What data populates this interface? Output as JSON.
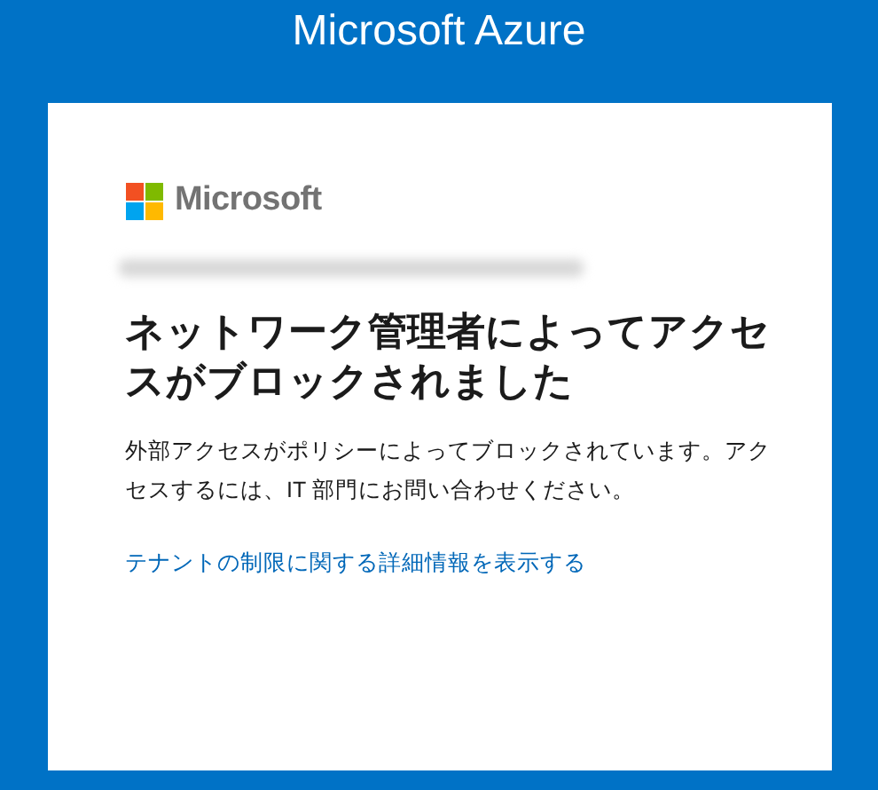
{
  "header": {
    "title": "Microsoft Azure"
  },
  "card": {
    "brand": "Microsoft",
    "heading": "ネットワーク管理者によってアクセスがブロックされました",
    "message": "外部アクセスがポリシーによってブロックされています。アクセスするには、IT 部門にお問い合わせください。",
    "link": "テナントの制限に関する詳細情報を表示する"
  }
}
